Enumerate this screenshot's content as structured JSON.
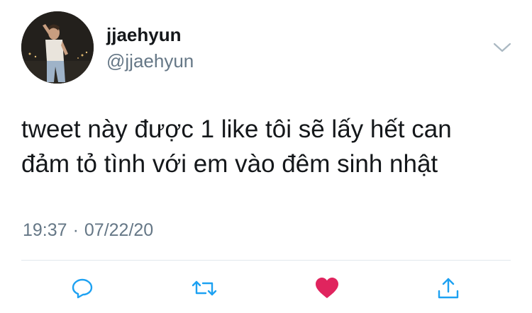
{
  "user": {
    "display_name": "jjaehyun",
    "handle": "@jjaehyun",
    "avatar_icon": "profile-photo"
  },
  "tweet": {
    "text_line1": "tweet này được 1 like tôi sẽ lấy hết can",
    "text_line2": "đảm tỏ tình với em vào đêm sinh nhật"
  },
  "meta": {
    "time": "19:37",
    "separator": "·",
    "date": "07/22/20"
  },
  "actions": {
    "reply_icon": "speech-bubble",
    "retweet_icon": "retweet-arrows",
    "like_icon": "heart",
    "share_icon": "upload-arrow",
    "liked": true
  },
  "colors": {
    "text": "#14171a",
    "muted": "#657786",
    "accent": "#1da1f2",
    "like": "#e0245e",
    "divider": "#e1e8ed"
  }
}
